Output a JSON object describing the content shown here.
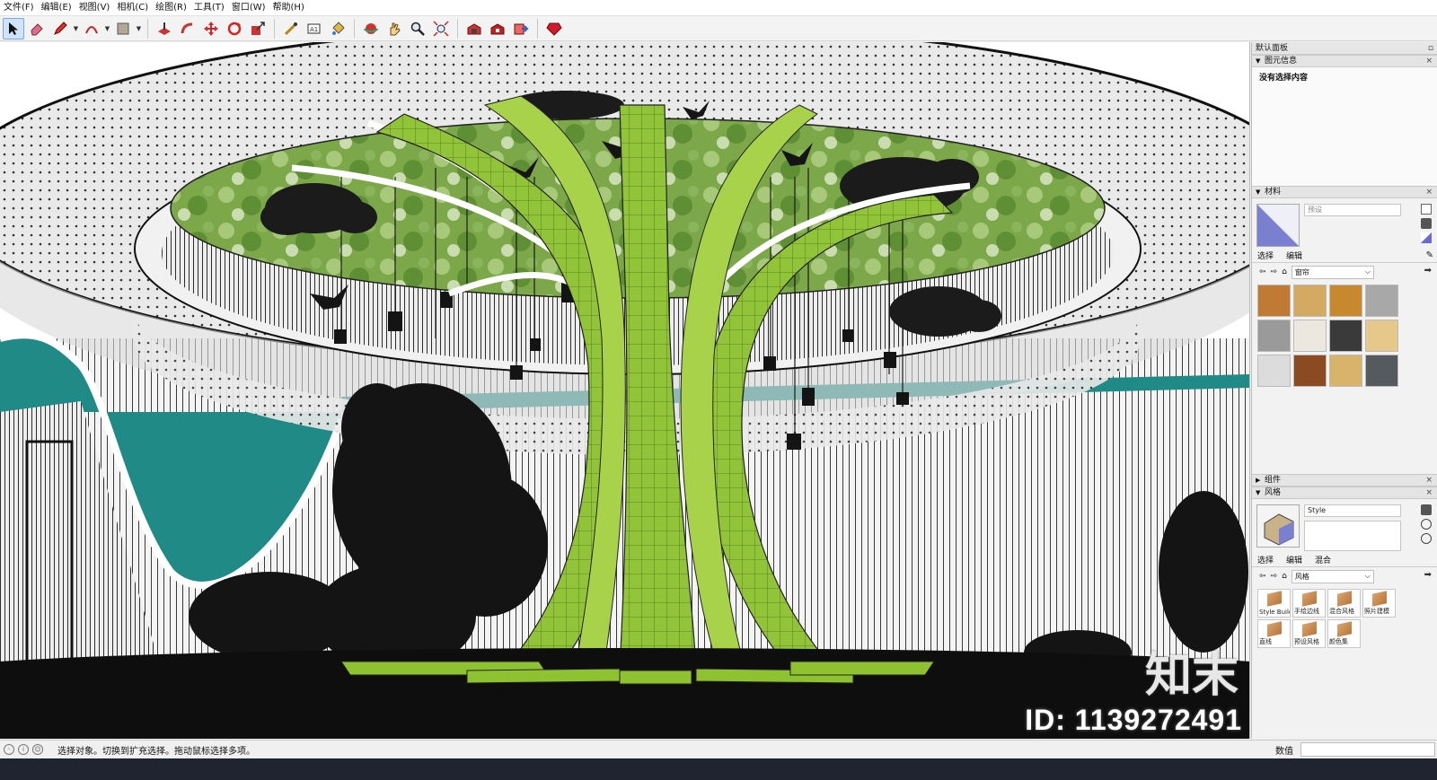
{
  "menubar": {
    "items": [
      "文件(F)",
      "编辑(E)",
      "视图(V)",
      "相机(C)",
      "绘图(R)",
      "工具(T)",
      "窗口(W)",
      "帮助(H)"
    ]
  },
  "toolbar": {
    "tools": [
      "select-icon",
      "eraser-icon",
      "pencil-line-icon",
      "arc-icon",
      "rectangle-icon",
      "push-pull-icon",
      "follow-me-icon",
      "move-icon",
      "rotate-icon",
      "scale-icon",
      "tape-measure-icon",
      "text-icon",
      "paint-bucket-icon",
      "orbit-icon",
      "pan-icon",
      "zoom-icon",
      "zoom-extents-icon",
      "warehouse-icon",
      "extension-warehouse-icon",
      "send-to-layout-icon",
      "ruby-icon"
    ]
  },
  "viewport": {
    "watermark_id": "ID: 1139272491",
    "watermark_logo": "知末"
  },
  "tray": {
    "title": "默认面板",
    "entity_info": {
      "header": "图元信息",
      "body": "没有选择内容"
    },
    "materials": {
      "header": "材料",
      "name_placeholder": "预设",
      "tab_select": "选择",
      "tab_edit": "编辑",
      "collection": "窗帘",
      "swatch_colors": [
        "#c07a33",
        "#d4aa63",
        "#c8892e",
        "#a8a8a8",
        "#9a9a9a",
        "#ece8e0",
        "#3a3a3a",
        "#e6c98a",
        "#dcdcdc",
        "#8b4a22",
        "#d8b36a",
        "#555a5e"
      ]
    },
    "components": {
      "header": "组件"
    },
    "styles": {
      "header": "风格",
      "name_value": "Style",
      "tab_select": "选择",
      "tab_edit": "编辑",
      "tab_mix": "混合",
      "collection": "风格",
      "items": [
        "Style Builder",
        "手绘边线",
        "混合风格",
        "照片建模",
        "直线",
        "预设风格",
        "颜色集"
      ]
    }
  },
  "statusbar": {
    "hint": "选择对象。切换到扩充选择。拖动鼠标选择多项。",
    "measure_label": "数值"
  },
  "colors": {
    "teal": "#1f8a86",
    "trunk_green": "#8fc230",
    "canopy": "#6fa23a"
  }
}
